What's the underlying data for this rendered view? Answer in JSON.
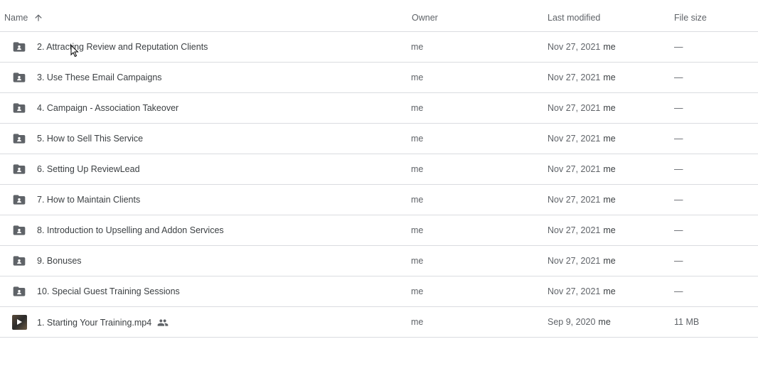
{
  "header": {
    "name": "Name",
    "owner": "Owner",
    "last_modified": "Last modified",
    "file_size": "File size",
    "sort_icon": "arrow-up-icon"
  },
  "rows": [
    {
      "type": "shared-folder",
      "icon": "shared-folder-icon",
      "name": "2. Attracting Review and Reputation Clients",
      "owner": "me",
      "date": "Nov 27, 2021",
      "modified_by": "me",
      "size": "—"
    },
    {
      "type": "shared-folder",
      "icon": "shared-folder-icon",
      "name": "3. Use These Email Campaigns",
      "owner": "me",
      "date": "Nov 27, 2021",
      "modified_by": "me",
      "size": "—"
    },
    {
      "type": "shared-folder",
      "icon": "shared-folder-icon",
      "name": "4. Campaign - Association Takeover",
      "owner": "me",
      "date": "Nov 27, 2021",
      "modified_by": "me",
      "size": "—"
    },
    {
      "type": "shared-folder",
      "icon": "shared-folder-icon",
      "name": "5. How to Sell This Service",
      "owner": "me",
      "date": "Nov 27, 2021",
      "modified_by": "me",
      "size": "—"
    },
    {
      "type": "shared-folder",
      "icon": "shared-folder-icon",
      "name": "6. Setting Up ReviewLead",
      "owner": "me",
      "date": "Nov 27, 2021",
      "modified_by": "me",
      "size": "—"
    },
    {
      "type": "shared-folder",
      "icon": "shared-folder-icon",
      "name": "7. How to Maintain Clients",
      "owner": "me",
      "date": "Nov 27, 2021",
      "modified_by": "me",
      "size": "—"
    },
    {
      "type": "shared-folder",
      "icon": "shared-folder-icon",
      "name": "8. Introduction to Upselling and Addon Services",
      "owner": "me",
      "date": "Nov 27, 2021",
      "modified_by": "me",
      "size": "—"
    },
    {
      "type": "shared-folder",
      "icon": "shared-folder-icon",
      "name": "9. Bonuses",
      "owner": "me",
      "date": "Nov 27, 2021",
      "modified_by": "me",
      "size": "—"
    },
    {
      "type": "shared-folder",
      "icon": "shared-folder-icon",
      "name": "10. Special Guest Training Sessions",
      "owner": "me",
      "date": "Nov 27, 2021",
      "modified_by": "me",
      "size": "—"
    },
    {
      "type": "video",
      "icon": "video-thumbnail-icon",
      "name": "1. Starting Your Training.mp4",
      "owner": "me",
      "date": "Sep 9, 2020",
      "modified_by": "me",
      "size": "11 MB",
      "shared": true,
      "shared_icon": "people-icon"
    }
  ],
  "colors": {
    "folder": "#5f6368",
    "border": "#dadce0",
    "text_primary": "#3c4043",
    "text_secondary": "#5f6368"
  }
}
